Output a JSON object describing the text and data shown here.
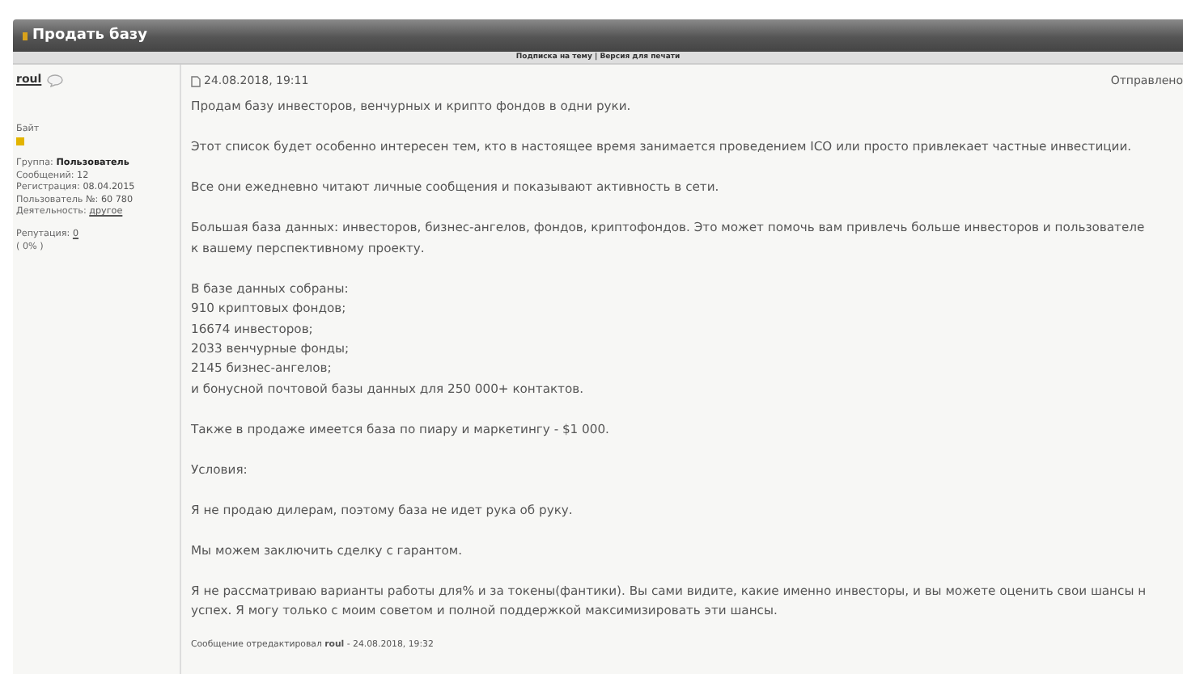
{
  "topic_title": "Продать базу",
  "topic_links": "Подписка на тему | Версия для печати",
  "author": {
    "name": "roul",
    "rank": "Байт",
    "info": [
      {
        "label": "Группа:",
        "value": "Пользователь",
        "kind": "bold"
      },
      {
        "label": "Сообщений:",
        "value": "12",
        "kind": "plain"
      },
      {
        "label": "Регистрация:",
        "value": "08.04.2015",
        "kind": "plain"
      },
      {
        "label": "Пользователь №:",
        "value": "60 780",
        "kind": "plain"
      },
      {
        "label": "Деятельность:",
        "value": "другое",
        "kind": "link"
      }
    ],
    "reputation_label": "Репутация:",
    "reputation_value": "0",
    "reputation_percent": "( 0% )"
  },
  "post": {
    "date": "24.08.2018, 19:11",
    "sent_label": "Отправлено",
    "paragraphs": [
      {
        "lines": [
          "Продам базу инвесторов, венчурных и крипто фондов в одни руки."
        ]
      },
      {
        "lines": [
          "Этот список будет особенно интересен тем, кто в настоящее время занимается проведением ICO или просто привлекает частные инвестиции."
        ]
      },
      {
        "lines": [
          "Все они ежедневно читают личные сообщения и показывают активность в сети."
        ]
      },
      {
        "lines": [
          "Большая база данных: инвесторов, бизнес-ангелов, фондов, криптофондов. Это может помочь вам привлечь больше инвесторов и пользователе",
          "к вашему перспективному проекту."
        ]
      },
      {
        "lines": [
          "В базе данных собраны:",
          "910 криптовых фондов;",
          "16674 инвесторов;",
          "2033 венчурные фонды;",
          "2145 бизнес-ангелов;",
          "и бонусной почтовой базы данных для 250 000+ контактов."
        ]
      },
      {
        "lines": [
          "Также в продаже имеется база по пиару и маркетингу - $1 000."
        ]
      },
      {
        "lines": [
          "Условия:"
        ]
      },
      {
        "lines": [
          "Я не продаю дилерам, поэтому база не идет рука об руку."
        ]
      },
      {
        "lines": [
          "Мы можем заключить сделку с гарантом."
        ]
      },
      {
        "lines": [
          "Я не рассматриваю варианты работы для% и за токены(фантики). Вы сами видите, какие именно инвесторы, и вы можете оценить свои шансы н",
          "успех. Я могу только с моим советом и полной поддержкой максимизировать эти шансы."
        ]
      }
    ],
    "edit_note": "Сообщение отредактировал **roul** - 24.08.2018, 19:32"
  }
}
